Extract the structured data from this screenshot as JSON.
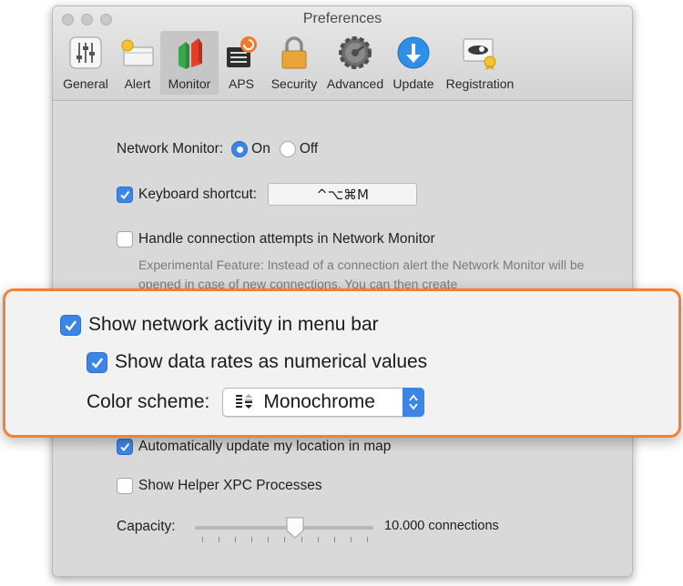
{
  "window": {
    "title": "Preferences"
  },
  "toolbar": {
    "items": [
      {
        "label": "General",
        "icon": "sliders-icon"
      },
      {
        "label": "Alert",
        "icon": "alert-icon"
      },
      {
        "label": "Monitor",
        "icon": "monitor-icon",
        "active": true
      },
      {
        "label": "APS",
        "icon": "aps-icon"
      },
      {
        "label": "Security",
        "icon": "lock-icon"
      },
      {
        "label": "Advanced",
        "icon": "gear-icon"
      },
      {
        "label": "Update",
        "icon": "download-icon"
      },
      {
        "label": "Registration",
        "icon": "registration-icon"
      }
    ]
  },
  "monitor": {
    "network_monitor_label": "Network Monitor:",
    "on_label": "On",
    "off_label": "Off",
    "keyboard_shortcut_label": "Keyboard shortcut:",
    "keyboard_shortcut_value": "^⌥⌘M",
    "handle_attempts_label": "Handle connection attempts in Network Monitor",
    "experimental_desc": "Experimental Feature: Instead of a connection alert the Network Monitor will be opened in case of new connections. You can then create",
    "auto_update_location_label": "Automatically update my location in map",
    "show_helper_label": "Show Helper XPC Processes",
    "capacity_label": "Capacity:",
    "capacity_value": "10.000 connections",
    "capacity_level": 0.56
  },
  "callout": {
    "show_activity_label": "Show network activity in menu bar",
    "show_rates_label": "Show data rates as numerical values",
    "color_scheme_label": "Color scheme:",
    "color_scheme_value": "Monochrome"
  },
  "colors": {
    "accent": "#3b85e6",
    "callout_border": "#f08232"
  }
}
